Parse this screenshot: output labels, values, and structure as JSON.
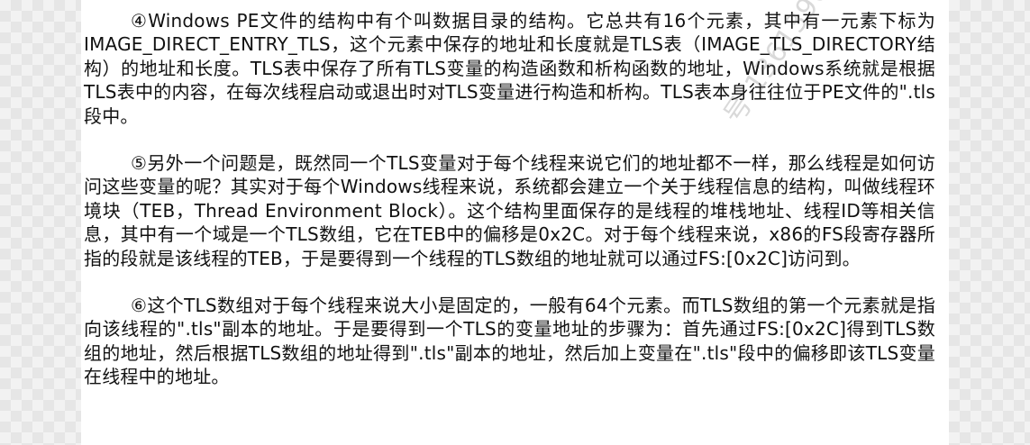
{
  "paragraphs": [
    "④Windows PE文件的结构中有个叫数据目录的结构。它总共有16个元素，其中有一元素下标为IMAGE_DIRECT_ENTRY_TLS，这个元素中保存的地址和长度就是TLS表（IMAGE_TLS_DIRECTORY结构）的地址和长度。TLS表中保存了所有TLS变量的构造函数和析构函数的地址，Windows系统就是根据TLS表中的内容，在每次线程启动或退出时对TLS变量进行构造和析构。TLS表本身往往位于PE文件的\".tls段中。",
    "⑤另外一个问题是，既然同一个TLS变量对于每个线程来说它们的地址都不一样，那么线程是如何访问这些变量的呢？其实对于每个Windows线程来说，系统都会建立一个关于线程信息的结构，叫做线程环境块（TEB，Thread Environment Block）。这个结构里面保存的是线程的堆栈地址、线程ID等相关信息，其中有一个域是一个TLS数组，它在TEB中的偏移是0x2C。对于每个线程来说，x86的FS段寄存器所指的段就是该线程的TEB，于是要得到一个线程的TLS数组的地址就可以通过FS:[0x2C]访问到。",
    "⑥这个TLS数组对于每个线程来说大小是固定的，一般有64个元素。而TLS数组的第一个元素就是指向该线程的\".tls\"副本的地址。于是要得到一个TLS的变量地址的步骤为：首先通过FS:[0x2C]得到TLS数组的地址，然后根据TLS数组的地址得到\".tls\"副本的地址，然后加上变量在\".tls\"段中的偏移即该TLS变量在线程中的地址。"
  ],
  "watermark": "号 13613908834242"
}
